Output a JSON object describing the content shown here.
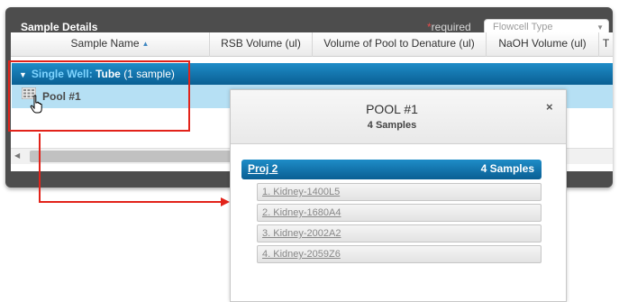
{
  "panel": {
    "title": "Sample Details",
    "required_star": "*",
    "required_label": "required",
    "flowcell_select": {
      "value": "Flowcell Type"
    }
  },
  "grid": {
    "columns": [
      {
        "label": "Sample Name",
        "sorted": "ascending"
      },
      {
        "label": "RSB Volume (ul)"
      },
      {
        "label": "Volume of Pool to Denature (ul)"
      },
      {
        "label": "NaOH Volume (ul)"
      },
      {
        "label": "T"
      }
    ],
    "group": {
      "prefix": "Single Well:",
      "name": "Tube",
      "count": "(1 sample)"
    },
    "row": {
      "name": "Pool #1"
    }
  },
  "popup": {
    "title": "POOL #1",
    "subtitle": "4 Samples",
    "close": "×",
    "project": {
      "name": "Proj 2",
      "count": "4 Samples"
    },
    "samples": [
      "1. Kidney-1400L5",
      "2. Kidney-1680A4",
      "3. Kidney-2002A2",
      "4. Kidney-2059Z6"
    ]
  },
  "colors": {
    "accent_blue": "#0a6ea8",
    "group_accent": "#7ed4ff",
    "selected_row": "#b6e0f4",
    "highlight": "#e2231a"
  }
}
